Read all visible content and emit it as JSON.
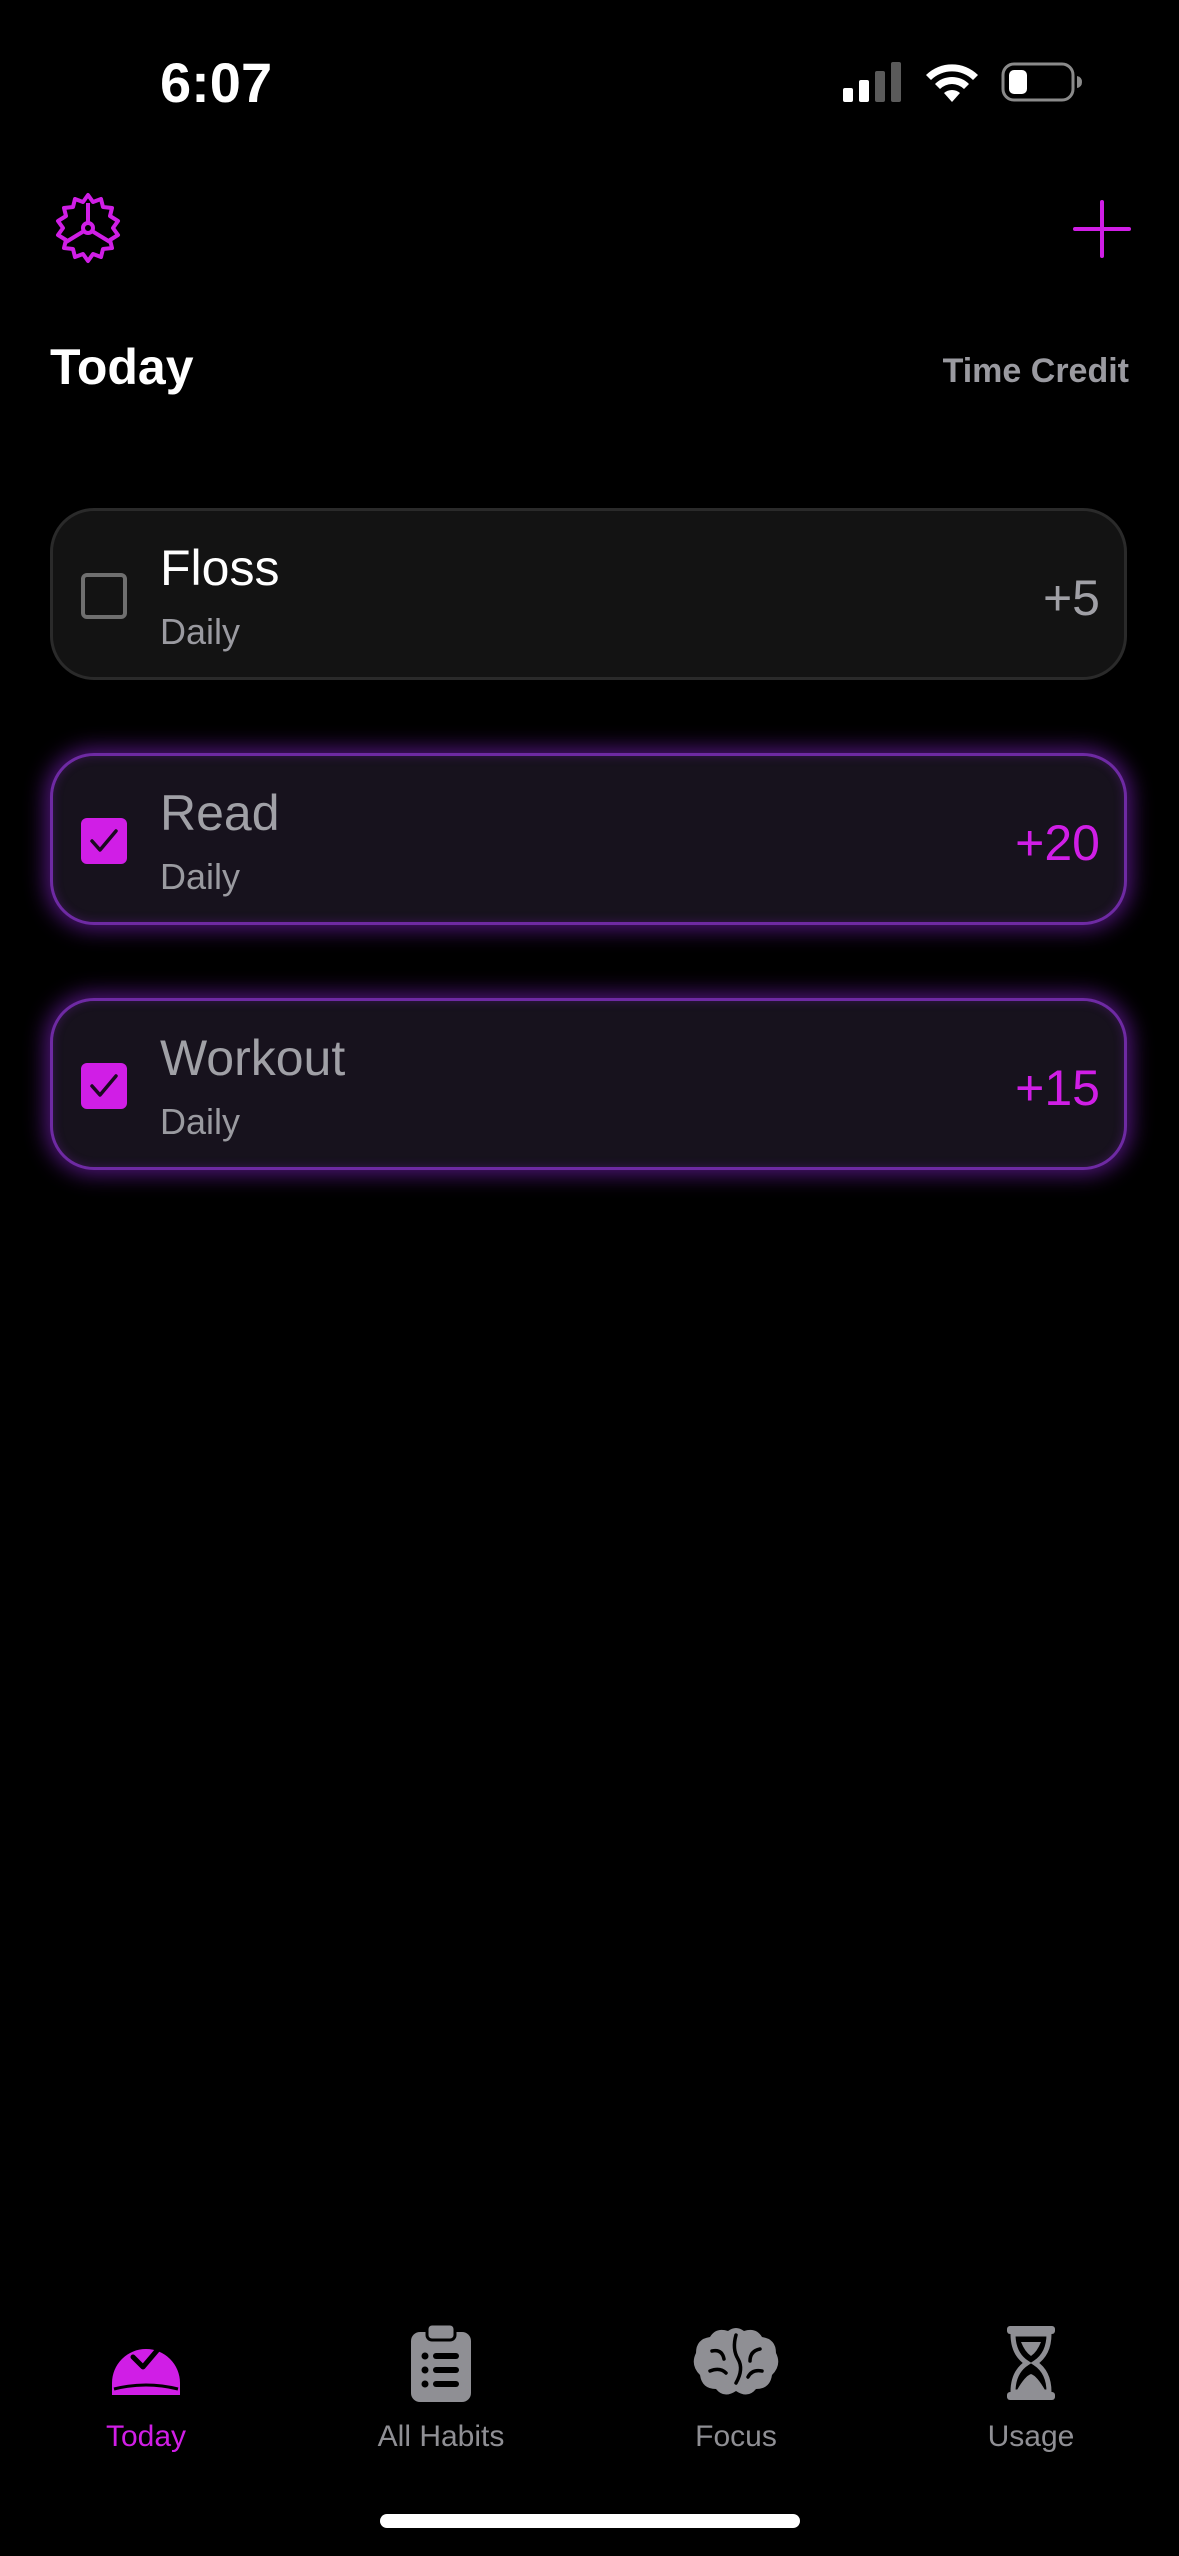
{
  "status_bar": {
    "time": "6:07",
    "icons": [
      "cellular-signal-icon",
      "wifi-icon",
      "battery-icon"
    ]
  },
  "header": {
    "title": "Today",
    "time_credit_label": "Time Credit",
    "settings_icon": "gear-icon",
    "add_icon": "plus-icon"
  },
  "habits": [
    {
      "name": "Floss",
      "frequency": "Daily",
      "points": "+5",
      "completed": false
    },
    {
      "name": "Read",
      "frequency": "Daily",
      "points": "+20",
      "completed": true
    },
    {
      "name": "Workout",
      "frequency": "Daily",
      "points": "+15",
      "completed": true
    }
  ],
  "tab_bar": {
    "tabs": [
      {
        "label": "Today",
        "icon": "today-check-icon",
        "active": true
      },
      {
        "label": "All Habits",
        "icon": "clipboard-list-icon",
        "active": false
      },
      {
        "label": "Focus",
        "icon": "brain-icon",
        "active": false
      },
      {
        "label": "Usage",
        "icon": "hourglass-icon",
        "active": false
      }
    ]
  },
  "colors": {
    "accent": "#d01ee6",
    "background": "#000000",
    "card": "#131313",
    "muted_text": "#9a9aa0"
  }
}
